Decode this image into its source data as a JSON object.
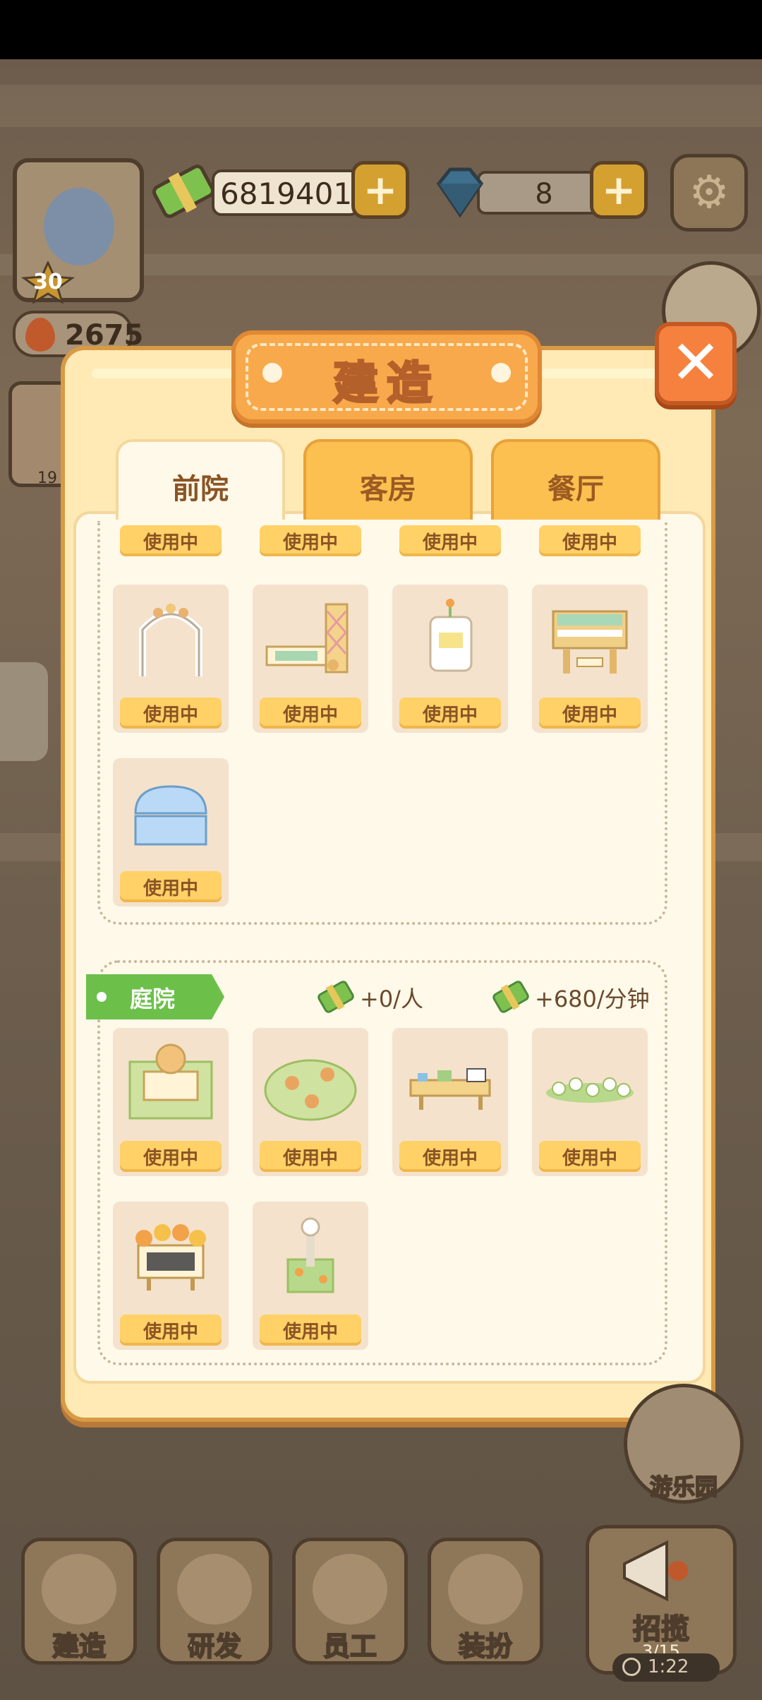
{
  "hud": {
    "cash": "6819401",
    "gems": "8",
    "energy": "2675",
    "level": "30",
    "side_event_time": "19"
  },
  "dialog": {
    "title": "建造",
    "tabs": [
      {
        "label": "前院",
        "active": true
      },
      {
        "label": "客房",
        "active": false
      },
      {
        "label": "餐厅",
        "active": false
      }
    ],
    "in_use_label": "使用中",
    "top_section": {
      "partial_row_count": 4,
      "items": [
        {
          "icon": "flower-arch"
        },
        {
          "icon": "bench-and-lattice"
        },
        {
          "icon": "price-sign-stand"
        },
        {
          "icon": "piano"
        },
        {
          "icon": "blue-arch"
        }
      ]
    },
    "courtyard": {
      "name": "庭院",
      "per_person": "+0/人",
      "per_minute": "+680/分钟",
      "items": [
        {
          "icon": "fountain-stand"
        },
        {
          "icon": "deer-lawn"
        },
        {
          "icon": "table-set"
        },
        {
          "icon": "white-flowers"
        },
        {
          "icon": "flower-board"
        },
        {
          "icon": "garden-lamp"
        }
      ]
    }
  },
  "bottom_nav": {
    "items": [
      {
        "label": "建造",
        "icon": "hardhat-icon"
      },
      {
        "label": "研发",
        "icon": "book-icon"
      },
      {
        "label": "员工",
        "icon": "chef-icon"
      },
      {
        "label": "装扮",
        "icon": "bow-icon"
      }
    ],
    "recruit": {
      "label": "招揽",
      "count": "3/15",
      "timer": "1:22"
    },
    "amusement": "游乐园"
  },
  "colors": {
    "panel_bg": "#ffe9b5",
    "title_orange": "#f8a94b",
    "close_orange": "#f6813f",
    "use_button": "#ffd166",
    "ribbon_green": "#6cc04a"
  }
}
